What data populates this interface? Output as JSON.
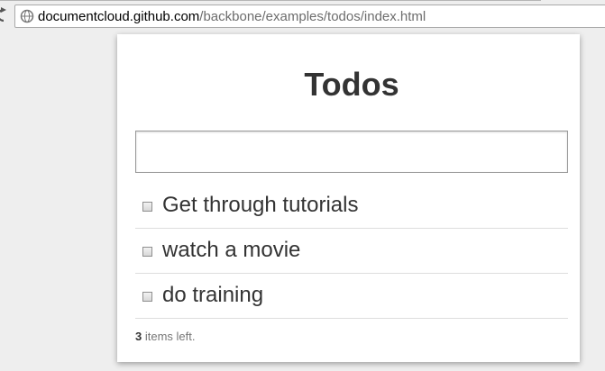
{
  "browser": {
    "url_host": "documentcloud.github.com",
    "url_path": "/backbone/examples/todos/index.html"
  },
  "app": {
    "title": "Todos",
    "new_todo": {
      "value": "",
      "placeholder": ""
    },
    "todos": [
      {
        "label": "Get through tutorials",
        "done": false
      },
      {
        "label": "watch a movie",
        "done": false
      },
      {
        "label": "do training",
        "done": false
      }
    ],
    "footer": {
      "remaining_count": "3",
      "remaining_text": "items left."
    }
  }
}
